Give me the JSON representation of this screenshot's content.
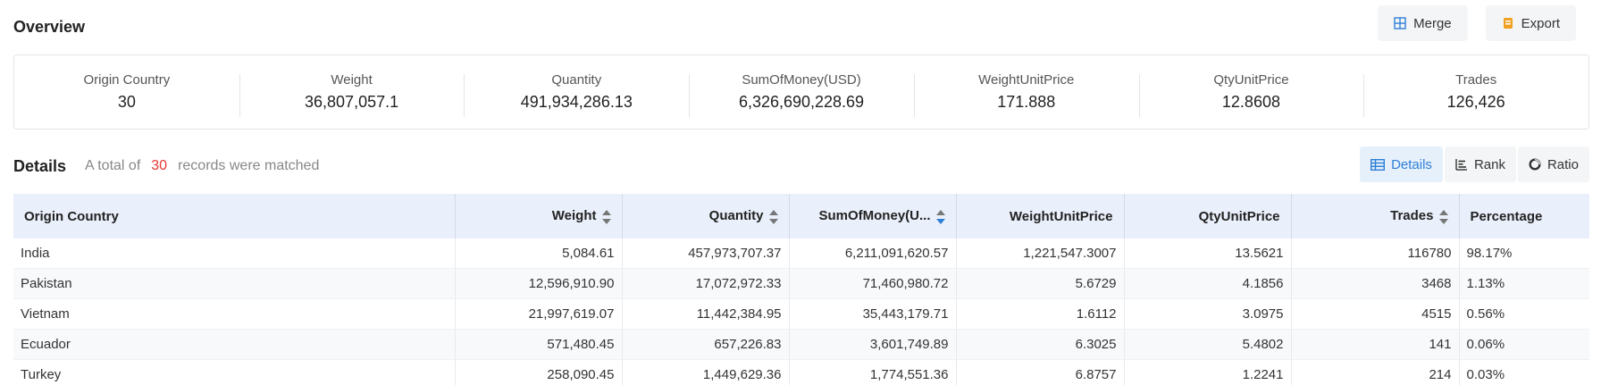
{
  "header": {
    "title": "Overview",
    "merge_label": "Merge",
    "export_label": "Export"
  },
  "summary": [
    {
      "label": "Origin Country",
      "value": "30"
    },
    {
      "label": "Weight",
      "value": "36,807,057.1"
    },
    {
      "label": "Quantity",
      "value": "491,934,286.13"
    },
    {
      "label": "SumOfMoney(USD)",
      "value": "6,326,690,228.69"
    },
    {
      "label": "WeightUnitPrice",
      "value": "171.888"
    },
    {
      "label": "QtyUnitPrice",
      "value": "12.8608"
    },
    {
      "label": "Trades",
      "value": "126,426"
    }
  ],
  "details": {
    "title": "Details",
    "sub_prefix": "A total of",
    "count": "30",
    "sub_suffix": "records were matched",
    "tabs": {
      "details": "Details",
      "rank": "Rank",
      "ratio": "Ratio"
    }
  },
  "colors": {
    "accent": "#2f7fd6",
    "count": "#e53935",
    "export_icon": "#f0a020",
    "merge_icon": "#2f7fd6"
  },
  "table": {
    "headers": [
      "Origin Country",
      "Weight",
      "Quantity",
      "SumOfMoney(U...",
      "WeightUnitPrice",
      "QtyUnitPrice",
      "Trades",
      "Percentage"
    ],
    "rows": [
      [
        "India",
        "5,084.61",
        "457,973,707.37",
        "6,211,091,620.57",
        "1,221,547.3007",
        "13.5621",
        "116780",
        "98.17%"
      ],
      [
        "Pakistan",
        "12,596,910.90",
        "17,072,972.33",
        "71,460,980.72",
        "5.6729",
        "4.1856",
        "3468",
        "1.13%"
      ],
      [
        "Vietnam",
        "21,997,619.07",
        "11,442,384.95",
        "35,443,179.71",
        "1.6112",
        "3.0975",
        "4515",
        "0.56%"
      ],
      [
        "Ecuador",
        "571,480.45",
        "657,226.83",
        "3,601,749.89",
        "6.3025",
        "5.4802",
        "141",
        "0.06%"
      ],
      [
        "Turkey",
        "258,090.45",
        "1,449,629.36",
        "1,774,551.36",
        "6.8757",
        "1.2241",
        "214",
        "0.03%"
      ]
    ]
  }
}
